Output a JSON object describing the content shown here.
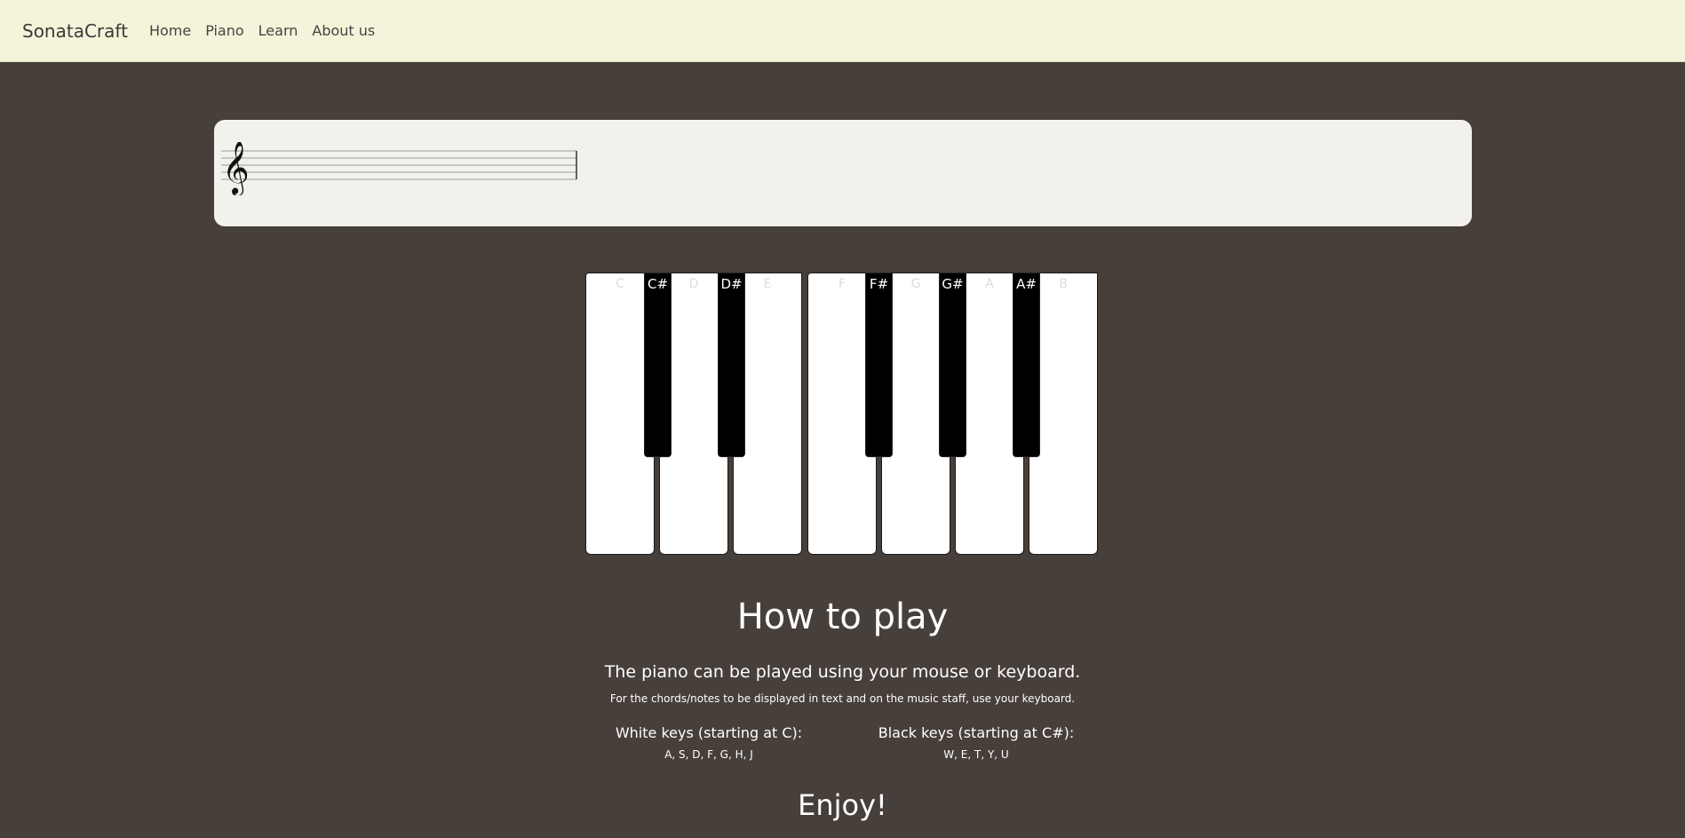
{
  "nav": {
    "brand": "SonataCraft",
    "links": [
      "Home",
      "Piano",
      "Learn",
      "About us"
    ]
  },
  "piano": {
    "white_keys": [
      "C",
      "D",
      "E",
      "F",
      "G",
      "A",
      "B"
    ],
    "black_keys": [
      "C#",
      "D#",
      "F#",
      "G#",
      "A#"
    ]
  },
  "howto": {
    "title": "How to play",
    "subtitle": "The piano can be played using your mouse or keyboard.",
    "note": "For the chords/notes to be displayed in text and on the music staff, use your keyboard.",
    "white_title": "White keys (starting at C):",
    "white_list": "A, S, D, F, G, H, J",
    "black_title": "Black keys (starting at C#):",
    "black_list": "W, E, T, Y, U",
    "enjoy": "Enjoy!"
  },
  "colors": {
    "background": "#473f3a",
    "navbar": "#f4f4da",
    "staff_panel": "#f3f1ec"
  },
  "icons": {
    "clef": "treble-clef-icon"
  }
}
